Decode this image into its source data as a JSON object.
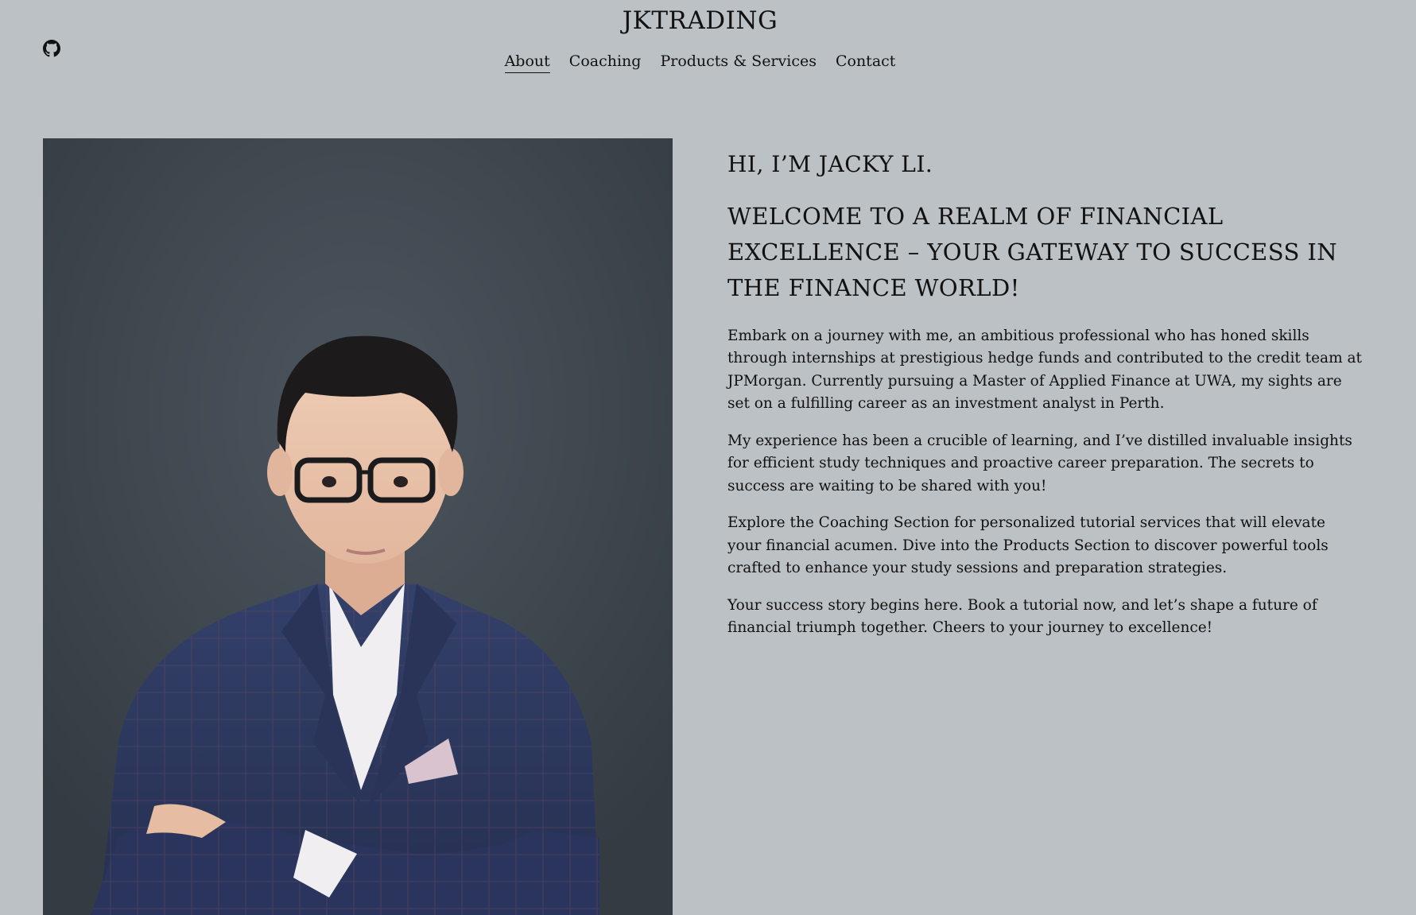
{
  "header": {
    "site_title": "JKTRADING",
    "github_icon": "github-icon"
  },
  "nav": {
    "items": [
      {
        "label": "About"
      },
      {
        "label": "Coaching"
      },
      {
        "label": "Products & Services"
      },
      {
        "label": "Contact"
      }
    ],
    "active": "About"
  },
  "hero": {
    "portrait_image": "portrait-photo"
  },
  "content": {
    "greeting": "HI, I’M JACKY LI.",
    "headline": "WELCOME TO A REALM OF FINANCIAL EXCELLENCE – YOUR GATEWAY TO SUCCESS IN THE FINANCE WORLD!",
    "paragraphs": [
      "Embark on a journey with me, an ambitious professional who has honed skills through internships at prestigious hedge funds and contributed to the credit team at JPMorgan. Currently pursuing a Master of Applied Finance at UWA, my sights are set on a fulfilling career as an investment analyst in Perth.",
      "My experience has been a crucible of learning, and I’ve distilled invaluable insights for efficient study techniques and proactive career preparation. The secrets to success are waiting to be shared with you!",
      "Explore the Coaching Section for personalized tutorial services that will elevate your financial acumen. Dive into the Products Section to discover powerful tools crafted to enhance your study sessions and preparation strategies.",
      "Your success story begins here. Book a tutorial now, and let’s shape a future of financial triumph together. Cheers to your journey to excellence!"
    ]
  },
  "colors": {
    "background": "#bcc1c5",
    "text": "#111111",
    "photo_backdrop": "#3c444c",
    "suit": "#2c3557"
  }
}
